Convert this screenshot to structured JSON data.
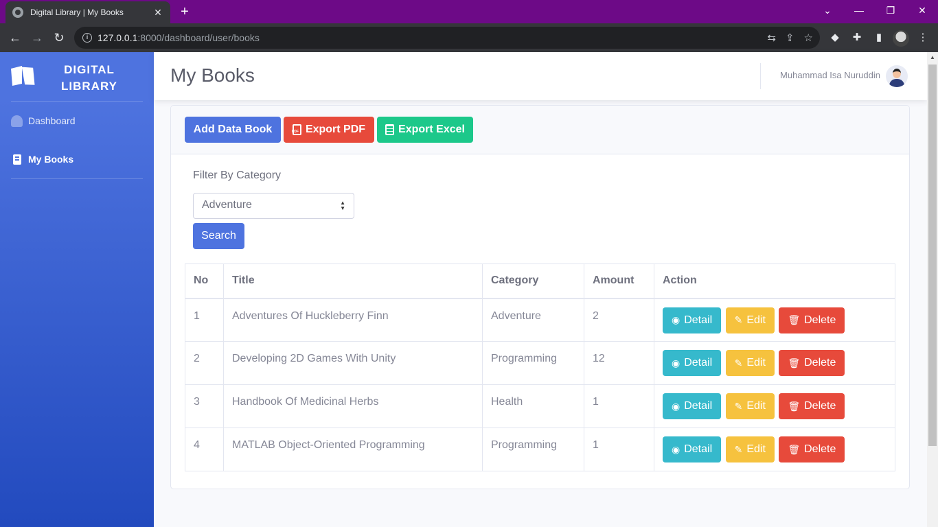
{
  "browser": {
    "tab_title": "Digital Library | My Books",
    "tab_close": "✕",
    "new_tab": "+",
    "url_host": "127.0.0.1",
    "url_path": ":8000/dashboard/user/books",
    "window_controls": [
      "⌄",
      "—",
      "❐",
      "✕"
    ]
  },
  "sidebar": {
    "brand": "DIGITAL\nLIBRARY",
    "items": [
      {
        "label": "Dashboard",
        "icon": "gauge-icon"
      },
      {
        "label": "My Books",
        "icon": "book-icon",
        "active": true
      }
    ]
  },
  "topbar": {
    "username": "Muhammad Isa Nuruddin"
  },
  "page": {
    "title": "My Books"
  },
  "actions": {
    "add": "Add Data Book",
    "export_pdf": "Export PDF",
    "export_excel": "Export Excel"
  },
  "filter": {
    "label": "Filter By Category",
    "selected": "Adventure",
    "search": "Search"
  },
  "table": {
    "headers": [
      "No",
      "Title",
      "Category",
      "Amount",
      "Action"
    ],
    "rows": [
      {
        "no": "1",
        "title": "Adventures Of Huckleberry Finn",
        "category": "Adventure",
        "amount": "2"
      },
      {
        "no": "2",
        "title": "Developing 2D Games With Unity",
        "category": "Programming",
        "amount": "12"
      },
      {
        "no": "3",
        "title": "Handbook Of Medicinal Herbs",
        "category": "Health",
        "amount": "1"
      },
      {
        "no": "4",
        "title": "MATLAB Object-Oriented Programming",
        "category": "Programming",
        "amount": "1"
      }
    ],
    "row_actions": {
      "detail": "Detail",
      "edit": "Edit",
      "delete": "Delete"
    }
  },
  "colors": {
    "primary": "#4e73df",
    "danger": "#e74a3b",
    "success": "#1cc88a",
    "info": "#36b9cc",
    "warning": "#f6c23e",
    "browser_frame": "#6d0a87"
  }
}
